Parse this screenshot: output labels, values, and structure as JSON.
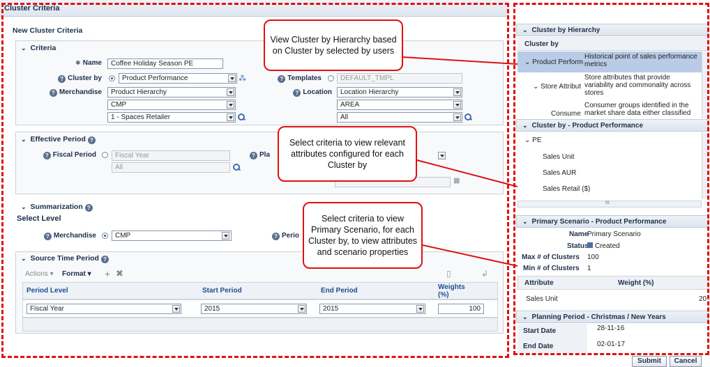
{
  "app_title": "Cluster Criteria",
  "page_title": "New Cluster Criteria",
  "criteria": {
    "header": "Criteria",
    "name_label": "Name",
    "name_value": "Coffee Holiday Season PE",
    "cluster_by_label": "Cluster by",
    "cluster_by_value": "Product Performance",
    "templates_label": "Templates",
    "templates_value": "DEFAULT_TMPL",
    "merchandise_label": "Merchandise",
    "merchandise_values": [
      "Product Hierarchy",
      "CMP",
      "1 - Spaces Retailer"
    ],
    "location_label": "Location",
    "location_values": [
      "Location Hierarchy",
      "AREA",
      "All"
    ]
  },
  "effective_period": {
    "header": "Effective Period",
    "fiscal_label": "Fiscal Period",
    "fiscal_values": [
      "Fiscal Year",
      "All"
    ],
    "planning_label": "Pla"
  },
  "summarization": {
    "header": "Summarization",
    "select_level": "Select Level",
    "merchandise_label": "Merchandise",
    "merchandise_value": "CMP",
    "period_label": "Perio"
  },
  "source_time": {
    "header": "Source Time Period",
    "actions": "Actions",
    "format": "Format",
    "columns": [
      "Period Level",
      "Start Period",
      "End Period",
      "Weights (%)"
    ],
    "row": {
      "level": "Fiscal Year",
      "start": "2015",
      "end": "2015",
      "weight": "100"
    }
  },
  "callouts": [
    "View Cluster by Hierarchy based on Cluster by  selected by users",
    "Select criteria to view relevant attributes configured  for each Cluster by",
    "Select criteria to view Primary Scenario, for each Cluster by, to view attributes and scenario properties"
  ],
  "right": {
    "hierarchy_header": "Cluster by Hierarchy",
    "hierarchy_col": "Cluster by",
    "hierarchy_rows": [
      {
        "name": "Product Perform",
        "desc": "Historical point of sales performance metrics"
      },
      {
        "name": "Store Attribut",
        "desc": "Store attributes that provide variability and commonality across stores"
      },
      {
        "name": "Consume",
        "desc": "Consumer groups identified in the market share data either classified"
      }
    ],
    "pp_header": "Cluster by - Product Performance",
    "pp_root": "PE",
    "pp_items": [
      "Sales Unit",
      "Sales AUR",
      "Sales Retail ($)"
    ],
    "scroll_mid": "III",
    "ps_header": "Primary Scenario - Product Performance",
    "ps_name_label": "Name",
    "ps_name_value": "Primary Scenario",
    "ps_status_label": "Status",
    "ps_status_value": "Created",
    "ps_max_label": "Max # of Clusters",
    "ps_max_value": "100",
    "ps_min_label": "Min # of Clusters",
    "ps_min_value": "1",
    "attr_col": "Attribute",
    "weight_col": "Weight (%)",
    "attr_row": {
      "name": "Sales Unit",
      "weight": "20"
    },
    "pp2_header": "Planning Period - Christmas / New Years",
    "start_label": "Start Date",
    "start_value": "28-11-16",
    "end_label": "End Date",
    "end_value": "02-01-17",
    "submit": "Submit",
    "cancel": "Cancel"
  },
  "colors": {
    "callout_border": "#e01010",
    "frame": "#e01010",
    "selected_row": "#b9cbe6"
  }
}
